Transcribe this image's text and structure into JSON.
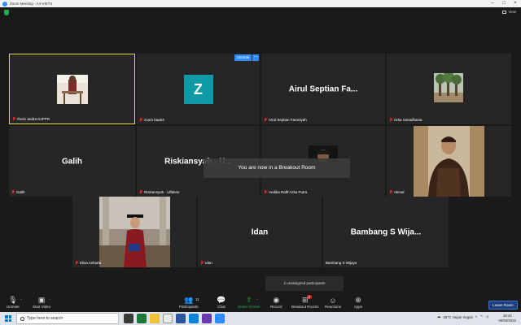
{
  "window": {
    "title": "Zoom Meeting - A4-VIET3",
    "view_label": "View"
  },
  "tiles": [
    {
      "name": "rhoric andra DJPPR",
      "big": ""
    },
    {
      "name": "zoom baa04",
      "big": "",
      "avatar_letter": "Z"
    },
    {
      "name": "Airul Septian Faroniyah",
      "big": "Airul Septian Fa..."
    },
    {
      "name": "rizka ramadhania",
      "big": ""
    },
    {
      "name": "Galih",
      "big": "Galih"
    },
    {
      "name": "Riskiansyah - Ulfakrie",
      "big": "Riskiansyah - U..."
    },
    {
      "name": "Andika Rafif Azka Putra",
      "big": ""
    },
    {
      "name": "Akmal",
      "big": ""
    },
    {
      "name": "Elisa Asharta",
      "big": ""
    },
    {
      "name": "Idan",
      "big": "Idan"
    },
    {
      "name": "Bambang S Wijaya",
      "big": "Bambang S Wija..."
    }
  ],
  "hover_controls": {
    "unmute": "Unmute",
    "more": "···"
  },
  "breakout_message": "You are now in a Breakout Room",
  "unassigned_text": "2 unassigned participants",
  "toolbar": {
    "unmute": "Unmute",
    "start_video": "Start Video",
    "participants": "Participants",
    "participants_count": "11",
    "chat": "Chat",
    "share_screen": "Share Screen",
    "record": "Record",
    "breakout_rooms": "Breakout Rooms",
    "breakout_badge": "2",
    "reactions": "Reactions",
    "apps": "Apps",
    "leave_room": "Leave Room"
  },
  "taskbar": {
    "search_placeholder": "Type here to search",
    "weather": "26°C  Hujan ringan",
    "time": "18:43",
    "date": "09/03/2022"
  },
  "colors": {
    "active_speaker_border": "#dfe32f",
    "zoom_blue": "#2d8cff",
    "share_green": "#22b14c",
    "muted_red": "#e02828",
    "avatar_teal": "#0e9aa7"
  }
}
